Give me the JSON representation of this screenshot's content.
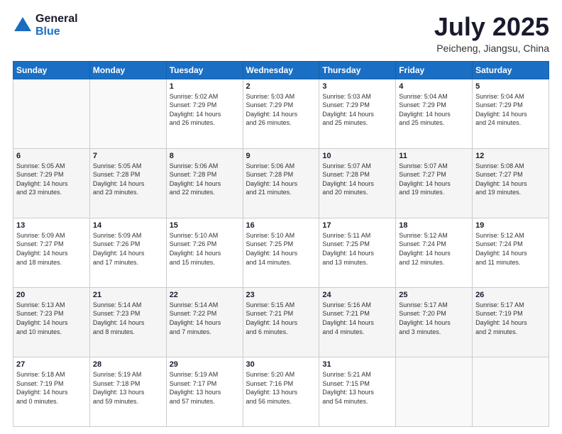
{
  "header": {
    "logo_general": "General",
    "logo_blue": "Blue",
    "month_title": "July 2025",
    "subtitle": "Peicheng, Jiangsu, China"
  },
  "weekdays": [
    "Sunday",
    "Monday",
    "Tuesday",
    "Wednesday",
    "Thursday",
    "Friday",
    "Saturday"
  ],
  "weeks": [
    [
      {
        "day": "",
        "info": ""
      },
      {
        "day": "",
        "info": ""
      },
      {
        "day": "1",
        "info": "Sunrise: 5:02 AM\nSunset: 7:29 PM\nDaylight: 14 hours\nand 26 minutes."
      },
      {
        "day": "2",
        "info": "Sunrise: 5:03 AM\nSunset: 7:29 PM\nDaylight: 14 hours\nand 26 minutes."
      },
      {
        "day": "3",
        "info": "Sunrise: 5:03 AM\nSunset: 7:29 PM\nDaylight: 14 hours\nand 25 minutes."
      },
      {
        "day": "4",
        "info": "Sunrise: 5:04 AM\nSunset: 7:29 PM\nDaylight: 14 hours\nand 25 minutes."
      },
      {
        "day": "5",
        "info": "Sunrise: 5:04 AM\nSunset: 7:29 PM\nDaylight: 14 hours\nand 24 minutes."
      }
    ],
    [
      {
        "day": "6",
        "info": "Sunrise: 5:05 AM\nSunset: 7:29 PM\nDaylight: 14 hours\nand 23 minutes."
      },
      {
        "day": "7",
        "info": "Sunrise: 5:05 AM\nSunset: 7:28 PM\nDaylight: 14 hours\nand 23 minutes."
      },
      {
        "day": "8",
        "info": "Sunrise: 5:06 AM\nSunset: 7:28 PM\nDaylight: 14 hours\nand 22 minutes."
      },
      {
        "day": "9",
        "info": "Sunrise: 5:06 AM\nSunset: 7:28 PM\nDaylight: 14 hours\nand 21 minutes."
      },
      {
        "day": "10",
        "info": "Sunrise: 5:07 AM\nSunset: 7:28 PM\nDaylight: 14 hours\nand 20 minutes."
      },
      {
        "day": "11",
        "info": "Sunrise: 5:07 AM\nSunset: 7:27 PM\nDaylight: 14 hours\nand 19 minutes."
      },
      {
        "day": "12",
        "info": "Sunrise: 5:08 AM\nSunset: 7:27 PM\nDaylight: 14 hours\nand 19 minutes."
      }
    ],
    [
      {
        "day": "13",
        "info": "Sunrise: 5:09 AM\nSunset: 7:27 PM\nDaylight: 14 hours\nand 18 minutes."
      },
      {
        "day": "14",
        "info": "Sunrise: 5:09 AM\nSunset: 7:26 PM\nDaylight: 14 hours\nand 17 minutes."
      },
      {
        "day": "15",
        "info": "Sunrise: 5:10 AM\nSunset: 7:26 PM\nDaylight: 14 hours\nand 15 minutes."
      },
      {
        "day": "16",
        "info": "Sunrise: 5:10 AM\nSunset: 7:25 PM\nDaylight: 14 hours\nand 14 minutes."
      },
      {
        "day": "17",
        "info": "Sunrise: 5:11 AM\nSunset: 7:25 PM\nDaylight: 14 hours\nand 13 minutes."
      },
      {
        "day": "18",
        "info": "Sunrise: 5:12 AM\nSunset: 7:24 PM\nDaylight: 14 hours\nand 12 minutes."
      },
      {
        "day": "19",
        "info": "Sunrise: 5:12 AM\nSunset: 7:24 PM\nDaylight: 14 hours\nand 11 minutes."
      }
    ],
    [
      {
        "day": "20",
        "info": "Sunrise: 5:13 AM\nSunset: 7:23 PM\nDaylight: 14 hours\nand 10 minutes."
      },
      {
        "day": "21",
        "info": "Sunrise: 5:14 AM\nSunset: 7:23 PM\nDaylight: 14 hours\nand 8 minutes."
      },
      {
        "day": "22",
        "info": "Sunrise: 5:14 AM\nSunset: 7:22 PM\nDaylight: 14 hours\nand 7 minutes."
      },
      {
        "day": "23",
        "info": "Sunrise: 5:15 AM\nSunset: 7:21 PM\nDaylight: 14 hours\nand 6 minutes."
      },
      {
        "day": "24",
        "info": "Sunrise: 5:16 AM\nSunset: 7:21 PM\nDaylight: 14 hours\nand 4 minutes."
      },
      {
        "day": "25",
        "info": "Sunrise: 5:17 AM\nSunset: 7:20 PM\nDaylight: 14 hours\nand 3 minutes."
      },
      {
        "day": "26",
        "info": "Sunrise: 5:17 AM\nSunset: 7:19 PM\nDaylight: 14 hours\nand 2 minutes."
      }
    ],
    [
      {
        "day": "27",
        "info": "Sunrise: 5:18 AM\nSunset: 7:19 PM\nDaylight: 14 hours\nand 0 minutes."
      },
      {
        "day": "28",
        "info": "Sunrise: 5:19 AM\nSunset: 7:18 PM\nDaylight: 13 hours\nand 59 minutes."
      },
      {
        "day": "29",
        "info": "Sunrise: 5:19 AM\nSunset: 7:17 PM\nDaylight: 13 hours\nand 57 minutes."
      },
      {
        "day": "30",
        "info": "Sunrise: 5:20 AM\nSunset: 7:16 PM\nDaylight: 13 hours\nand 56 minutes."
      },
      {
        "day": "31",
        "info": "Sunrise: 5:21 AM\nSunset: 7:15 PM\nDaylight: 13 hours\nand 54 minutes."
      },
      {
        "day": "",
        "info": ""
      },
      {
        "day": "",
        "info": ""
      }
    ]
  ]
}
